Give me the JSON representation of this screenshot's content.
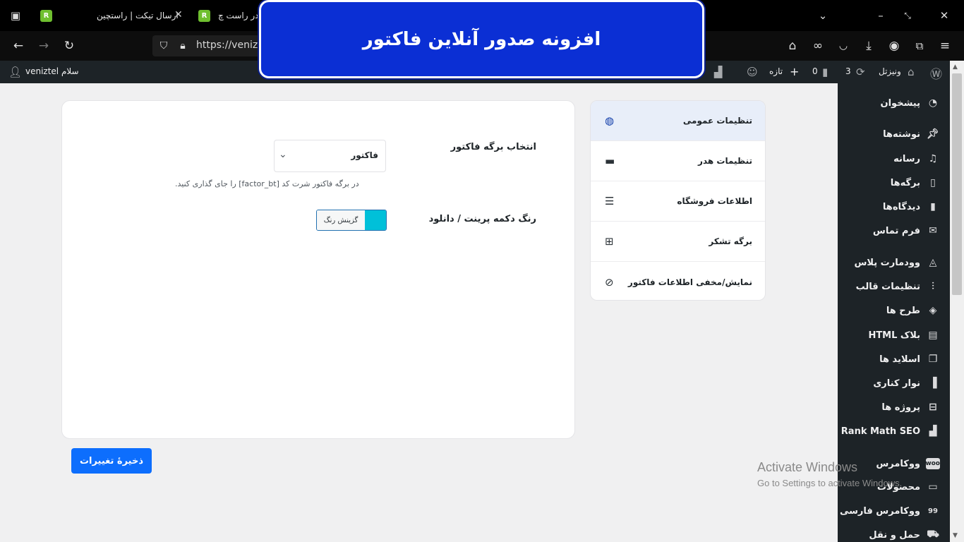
{
  "browser": {
    "tabs": [
      {
        "title": "ارسال تیکت | راستچین"
      },
      {
        "title": "در راست چ"
      }
    ],
    "url": "https://venizte"
  },
  "admin_bar": {
    "greeting": "سلام veniztel",
    "site_name": "ونیزتل",
    "updates_count": "3",
    "comments_count": "0",
    "new_label": "تازه",
    "rank_count": "0"
  },
  "sidebar": {
    "items": [
      {
        "label": "پیشخوان",
        "icon": "dashboard-icon"
      },
      {
        "label": "نوشته‌ها",
        "icon": "pin-icon"
      },
      {
        "label": "رسانه",
        "icon": "media-icon"
      },
      {
        "label": "برگه‌ها",
        "icon": "page-icon"
      },
      {
        "label": "دیدگاه‌ها",
        "icon": "comment-icon"
      },
      {
        "label": "فرم تماس",
        "icon": "mail-icon"
      },
      {
        "label": "وودمارت پلاس",
        "icon": "woodmart-icon"
      },
      {
        "label": "تنظیمات قالب",
        "icon": "sliders-icon"
      },
      {
        "label": "طرح ها",
        "icon": "layers-icon"
      },
      {
        "label": "بلاک HTML",
        "icon": "html-icon"
      },
      {
        "label": "اسلاید ها",
        "icon": "slides-icon"
      },
      {
        "label": "نوار کناری",
        "icon": "sidebar-icon"
      },
      {
        "label": "پروژه ها",
        "icon": "briefcase-icon"
      },
      {
        "label": "Rank Math SEO",
        "icon": "rankmath-icon"
      },
      {
        "label": "ووکامرس",
        "icon": "woo-icon"
      },
      {
        "label": "محصولات",
        "icon": "archive-icon"
      },
      {
        "label": "ووکامرس فارسی",
        "icon": "woo-fa-icon"
      },
      {
        "label": "حمل و نقل",
        "icon": "truck-icon"
      }
    ]
  },
  "settings_nav": {
    "items": [
      {
        "label": "تنظیمات عمومی",
        "icon": "globe-icon"
      },
      {
        "label": "تنظیمات هدر",
        "icon": "monitor-icon"
      },
      {
        "label": "اطلاعات فروشگاه",
        "icon": "list-icon"
      },
      {
        "label": "برگه تشکر",
        "icon": "gift-icon"
      },
      {
        "label": "نمایش/مخفی اطلاعات فاکتور",
        "icon": "eye-slash-icon"
      }
    ]
  },
  "form": {
    "invoice_page_label": "انتخاب برگه فاکتور",
    "invoice_page_value": "فاکتور",
    "invoice_hint": "در برگه فاکتور شرت کد [factor_bt] را جای گذاری کنید.",
    "button_color_label": "رنگ دکمه پرینت / دانلود",
    "color_picker_label": "گزینش رنگ",
    "button_color": "#00c0d9"
  },
  "save_button": "ذخیرهٔ تغییرات",
  "banner": "افزونه صدور آنلاین فاکتور",
  "activate_windows": {
    "title": "Activate Windows",
    "subtitle": "Go to Settings to activate Windows."
  }
}
